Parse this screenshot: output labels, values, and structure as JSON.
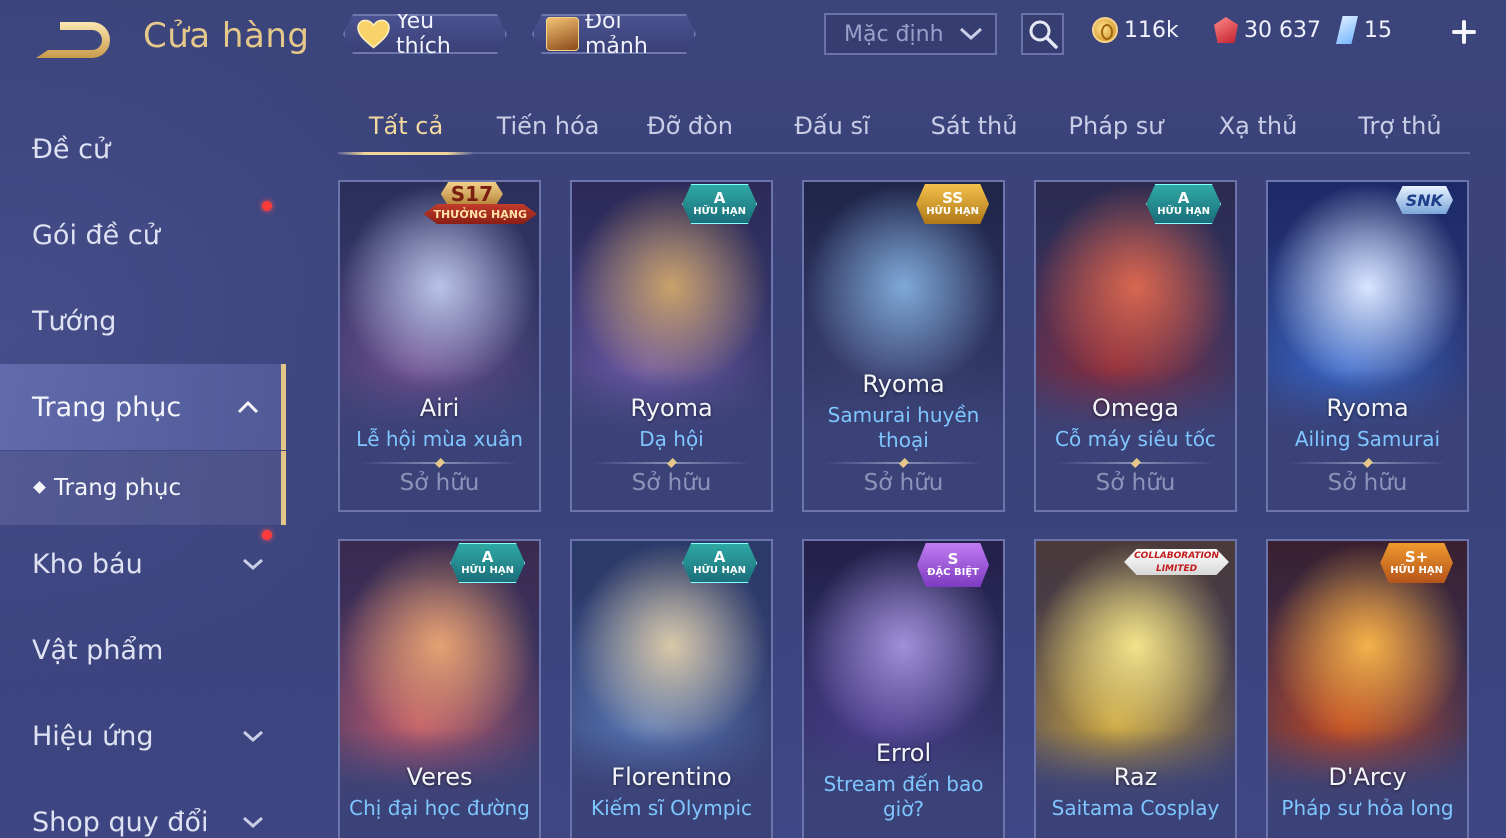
{
  "header": {
    "title": "Cửa hàng",
    "favorites_label": "Yêu thích",
    "exchange_label": "Đổi mảnh",
    "sort_value": "Mặc định",
    "currencies": [
      {
        "icon": "gold-coin-icon",
        "amount": "116k"
      },
      {
        "icon": "red-gem-icon",
        "amount": "30 637"
      },
      {
        "icon": "voucher-icon",
        "amount": "15"
      }
    ]
  },
  "sidebar": {
    "items": [
      {
        "label": "Đề cử"
      },
      {
        "label": "Gói đề cử"
      },
      {
        "label": "Tướng"
      },
      {
        "label": "Trang phục"
      },
      {
        "label": "Trang phục"
      },
      {
        "label": "Kho báu"
      },
      {
        "label": "Vật phẩm"
      },
      {
        "label": "Hiệu ứng"
      },
      {
        "label": "Shop quy đổi"
      }
    ]
  },
  "tabs": [
    {
      "label": "Tất cả"
    },
    {
      "label": "Tiến hóa"
    },
    {
      "label": "Đỡ đòn"
    },
    {
      "label": "Đấu sĩ"
    },
    {
      "label": "Sát thủ"
    },
    {
      "label": "Pháp sư"
    },
    {
      "label": "Xạ thủ"
    },
    {
      "label": "Trợ thủ"
    }
  ],
  "cards": [
    {
      "hero": "Airi",
      "skin": "Lễ hội mùa xuân",
      "status": "Sở hữu",
      "badge_top": "S17",
      "badge_sub": "THƯỞNG HẠNG",
      "colors": [
        "#b8c3e6",
        "#6f4e8f",
        "#2b2f5a"
      ]
    },
    {
      "hero": "Ryoma",
      "skin": "Dạ hội",
      "status": "Sở hữu",
      "badge_top": "A",
      "badge_sub": "HỮU HẠN",
      "colors": [
        "#c9a16a",
        "#6f5aa8",
        "#2d2a5a"
      ]
    },
    {
      "hero": "Ryoma",
      "skin": "Samurai huyền thoại",
      "status": "Sở hữu",
      "badge_top": "SS",
      "badge_sub": "HỮU HẠN",
      "colors": [
        "#7fa9d8",
        "#3a3f6e",
        "#1f2548"
      ]
    },
    {
      "hero": "Omega",
      "skin": "Cỗ máy siêu tốc",
      "status": "Sở hữu",
      "badge_top": "A",
      "badge_sub": "HỮU HẠN",
      "colors": [
        "#d9674f",
        "#8a2a3a",
        "#2c2a50"
      ]
    },
    {
      "hero": "Ryoma",
      "skin": "Ailing Samurai",
      "status": "Sở hữu",
      "badge_top": "SNK",
      "badge_sub": "",
      "colors": [
        "#d9e6ff",
        "#3766c9",
        "#1c2a6a"
      ]
    },
    {
      "hero": "Veres",
      "skin": "Chị đại học đường",
      "status": "",
      "badge_top": "A",
      "badge_sub": "HỮU HẠN",
      "colors": [
        "#e4a272",
        "#c25a6a",
        "#3a2a50"
      ]
    },
    {
      "hero": "Florentino",
      "skin": "Kiếm sĩ Olympic",
      "status": "",
      "badge_top": "A",
      "badge_sub": "HỮU HẠN",
      "colors": [
        "#d8c8a8",
        "#5a7ab8",
        "#2a3a6a"
      ]
    },
    {
      "hero": "Errol",
      "skin": "Stream đến bao giờ?",
      "status": "",
      "badge_top": "S",
      "badge_sub": "ĐẶC BIỆT",
      "colors": [
        "#a08fd8",
        "#4a3a8a",
        "#23204a"
      ]
    },
    {
      "hero": "Raz",
      "skin": "Saitama Cosplay",
      "status": "",
      "badge_top": "COLLABORATION",
      "badge_sub": "LIMITED",
      "colors": [
        "#f2e38a",
        "#c9a23a",
        "#4a3a3a"
      ]
    },
    {
      "hero": "D'Arcy",
      "skin": "Pháp sư hỏa long",
      "status": "",
      "badge_top": "S+",
      "badge_sub": "HỮU HẠN",
      "colors": [
        "#f5b24a",
        "#c2461f",
        "#3a2030"
      ]
    }
  ]
}
